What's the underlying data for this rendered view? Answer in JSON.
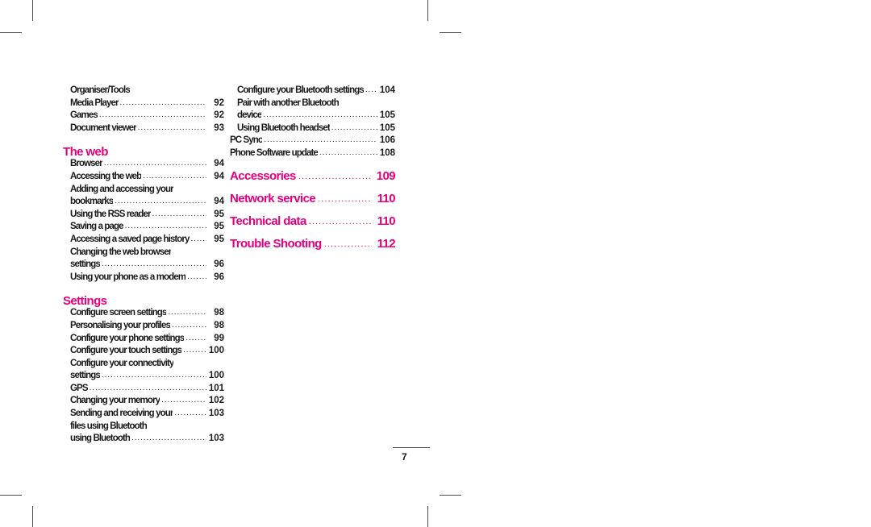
{
  "document": {
    "type": "table-of-contents",
    "page_number": "7",
    "accent_color": "#e5007d",
    "text_color": "#1a1a1a",
    "leader_dots": "..............................................................................................."
  },
  "left_column": {
    "sections": [
      {
        "heading": null,
        "entries": [
          {
            "label": "Organiser/Tools",
            "page": "",
            "wrap": true,
            "indent": true
          },
          {
            "label": "Media Player",
            "page": "92",
            "wrap": false,
            "indent": true
          },
          {
            "label": "Games",
            "page": "92",
            "wrap": false,
            "indent": true
          },
          {
            "label": "Document viewer",
            "page": "93",
            "wrap": false,
            "indent": true
          }
        ]
      },
      {
        "heading": "The web",
        "entries": [
          {
            "label": "Browser",
            "page": "94",
            "wrap": false,
            "indent": true
          },
          {
            "label": "Accessing the web",
            "page": "94",
            "wrap": false,
            "indent": true
          },
          {
            "label": "Adding and accessing your",
            "page": "",
            "wrap": true,
            "indent": true
          },
          {
            "label": "bookmarks",
            "page": "94",
            "wrap": false,
            "indent": true
          },
          {
            "label": "Using the RSS reader",
            "page": "95",
            "wrap": false,
            "indent": true
          },
          {
            "label": "Saving a page",
            "page": "95",
            "wrap": false,
            "indent": true
          },
          {
            "label": "Accessing a saved page history",
            "page": "95",
            "wrap": false,
            "indent": true
          },
          {
            "label": "Changing the web browser",
            "page": "",
            "wrap": true,
            "indent": true
          },
          {
            "label": "settings",
            "page": "96",
            "wrap": false,
            "indent": true
          },
          {
            "label": "Using your phone as a modem",
            "page": "96",
            "wrap": false,
            "indent": true
          }
        ]
      },
      {
        "heading": "Settings",
        "entries": [
          {
            "label": "Configure screen settings",
            "page": "98",
            "wrap": false,
            "indent": true
          },
          {
            "label": "Personalising your profiles",
            "page": "98",
            "wrap": false,
            "indent": true
          },
          {
            "label": "Configure your phone settings",
            "page": "99",
            "wrap": false,
            "indent": true
          },
          {
            "label": "Configure your touch settings",
            "page": "100",
            "wrap": false,
            "indent": true
          },
          {
            "label": "Configure your connectivity",
            "page": "",
            "wrap": true,
            "indent": true
          },
          {
            "label": "settings",
            "page": "100",
            "wrap": false,
            "indent": true
          },
          {
            "label": "GPS",
            "page": "101",
            "wrap": false,
            "indent": true
          },
          {
            "label": "Changing your memory",
            "page": "102",
            "wrap": false,
            "indent": true
          },
          {
            "label": "Sending and receiving your",
            "page": "103",
            "wrap": false,
            "indent": true
          },
          {
            "label": "files using Bluetooth",
            "page": "",
            "wrap": true,
            "indent": true
          },
          {
            "label": "using Bluetooth",
            "page": "103",
            "wrap": false,
            "indent": true
          }
        ]
      }
    ]
  },
  "right_column": {
    "sections": [
      {
        "heading": null,
        "entries": [
          {
            "label": "Configure your Bluetooth settings",
            "page": "104",
            "wrap": false,
            "indent": true
          },
          {
            "label": "Pair with another Bluetooth",
            "page": "",
            "wrap": true,
            "indent": true
          },
          {
            "label": "device",
            "page": "105",
            "wrap": false,
            "indent": true
          },
          {
            "label": "Using Bluetooth headset",
            "page": "105",
            "wrap": false,
            "indent": true
          },
          {
            "label": "PC Sync",
            "page": "106",
            "wrap": false,
            "indent": false
          },
          {
            "label": "Phone Software update",
            "page": "108",
            "wrap": false,
            "indent": false
          }
        ]
      }
    ],
    "heading_entries": [
      {
        "label": "Accessories",
        "page": "109"
      },
      {
        "label": "Network service",
        "page": "110"
      },
      {
        "label": "Technical data",
        "page": "110"
      },
      {
        "label": "Trouble Shooting",
        "page": "112"
      }
    ]
  }
}
